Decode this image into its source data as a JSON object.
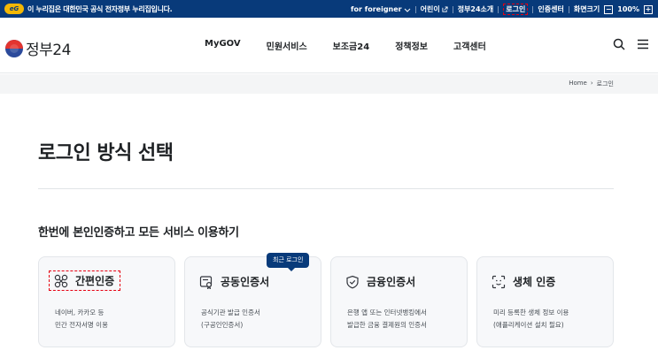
{
  "topbar": {
    "badge": "eG",
    "notice": "이 누리집은 대한민국 공식 전자정부 누리집입니다.",
    "foreigner": "for foreigner",
    "kids": "어린이",
    "about": "정부24소개",
    "login": "로그인",
    "cert_center": "인증센터",
    "screen_size": "화면크기",
    "zoom": "100%",
    "zoom_minus": "−",
    "zoom_plus": "+"
  },
  "header": {
    "logo_text": "정부24",
    "nav": [
      "MyGOV",
      "민원서비스",
      "보조금24",
      "정책정보",
      "고객센터"
    ]
  },
  "breadcrumb": {
    "home": "Home",
    "sep": "›",
    "current": "로그인"
  },
  "page": {
    "title": "로그인 방식 선택",
    "section_title": "한번에 본인인증하고 모든 서비스 이용하기",
    "recent_badge": "최근 로그인"
  },
  "cards": [
    {
      "title": "간편인증",
      "icon": "simple-auth-icon",
      "desc1": "네이버, 카카오 등",
      "desc2": "민간 전자서명 이용"
    },
    {
      "title": "공동인증서",
      "icon": "joint-certificate-icon",
      "desc1": "공식기관 발급 인증서",
      "desc2": "(구공인인증서)"
    },
    {
      "title": "금융인증서",
      "icon": "shield-icon",
      "desc1": "은행 앱 또는 인터넷뱅킹에서",
      "desc2": "발급한 금융 결제원의 인증서"
    },
    {
      "title": "생체 인증",
      "icon": "face-scan-icon",
      "desc1": "미리 등록한 생체 정보 이용",
      "desc2": "(애플리케이션 설치 필요)"
    }
  ],
  "colors": {
    "topbar": "#083a7a",
    "highlight": "#e60012",
    "badge": "#083a7a"
  }
}
